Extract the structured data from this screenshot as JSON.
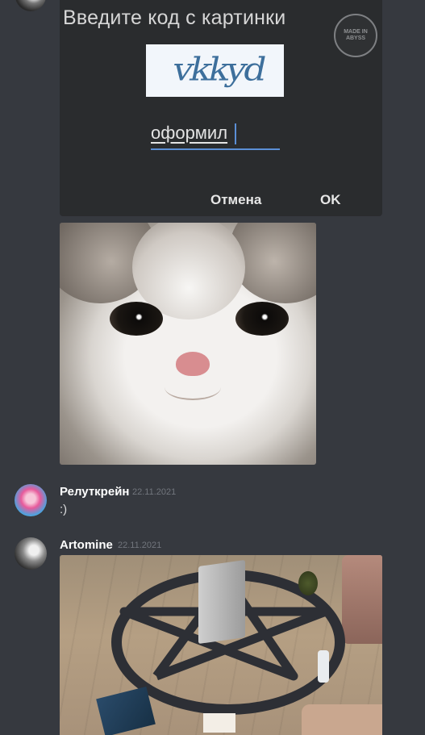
{
  "captcha": {
    "title": "Введите код с картинки",
    "badge_text": "MADE IN\nABYSS",
    "captcha_code": "vkkyd",
    "input_value": "оформил",
    "cancel_label": "Отмена",
    "ok_label": "OK"
  },
  "messages": [
    {
      "author": "Релуткрейн",
      "timestamp": "22.11.2021",
      "text": ":)"
    },
    {
      "author": "Artomine",
      "timestamp": "22.11.2021"
    }
  ],
  "colors": {
    "background": "#36393f",
    "author": "#ffffff",
    "timestamp": "#72767d",
    "message_text": "#dcddde",
    "input_accent": "#5b8fd6"
  }
}
